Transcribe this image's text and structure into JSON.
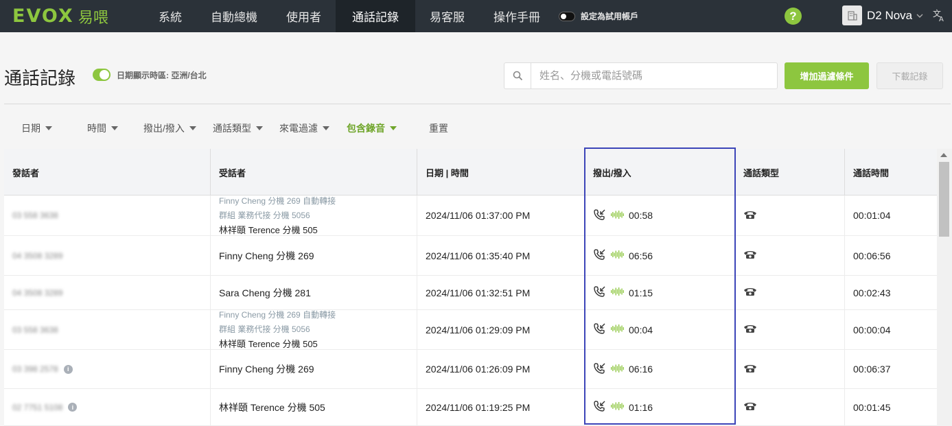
{
  "nav": {
    "logo_text": "EVOX",
    "logo_cn": "易喂",
    "items": [
      "系統",
      "自動總機",
      "使用者",
      "通話記錄",
      "易客服",
      "操作手冊"
    ],
    "active_index": 3,
    "trial_label": "設定為試用帳戶",
    "help": "?",
    "account_name": "D2 Nova",
    "lang_icon": "translate-icon"
  },
  "header": {
    "title": "通話記錄",
    "timezone_label": "日期顯示時區: 亞洲/台北",
    "search_placeholder": "姓名、分機或電話號碼",
    "add_filter": "增加過濾條件",
    "download": "下載記錄"
  },
  "filters": [
    "日期",
    "時間",
    "撥出/撥入",
    "通話類型",
    "來電過濾",
    "包含錄音"
  ],
  "filter_reset": "重置",
  "active_filter": "包含錄音",
  "table": {
    "columns": [
      "發話者",
      "受話者",
      "日期 | 時間",
      "撥出/撥入",
      "通話類型",
      "通話時間"
    ],
    "rows": [
      {
        "caller": "03 558 3638",
        "info": false,
        "callee_sub1": "Finny Cheng  分機 269  自動轉接",
        "callee_sub2": "群組  業務代接  分機 5056",
        "callee": "林祥頤 Terence  分機 505",
        "datetime": "2024/11/06 01:37:00 PM",
        "ring": "00:58",
        "duration": "00:01:04"
      },
      {
        "caller": "04 3508 3289",
        "info": false,
        "callee_sub1": "",
        "callee_sub2": "",
        "callee": "Finny Cheng  分機 269",
        "datetime": "2024/11/06 01:35:40 PM",
        "ring": "06:56",
        "duration": "00:06:56"
      },
      {
        "caller": "04 3508 3289",
        "info": false,
        "callee_sub1": "",
        "callee_sub2": "",
        "callee": "Sara Cheng  分機 281",
        "datetime": "2024/11/06 01:32:51 PM",
        "ring": "01:15",
        "duration": "00:02:43"
      },
      {
        "caller": "03 558 3638",
        "info": false,
        "callee_sub1": "Finny Cheng  分機 269  自動轉接",
        "callee_sub2": "群組  業務代接  分機 5056",
        "callee": "林祥頤 Terence  分機 505",
        "datetime": "2024/11/06 01:29:09 PM",
        "ring": "00:04",
        "duration": "00:00:04"
      },
      {
        "caller": "03 398 2578",
        "info": true,
        "callee_sub1": "",
        "callee_sub2": "",
        "callee": "Finny Cheng  分機 269",
        "datetime": "2024/11/06 01:26:09 PM",
        "ring": "06:16",
        "duration": "00:06:37"
      },
      {
        "caller": "02 7751 5108",
        "info": true,
        "callee_sub1": "",
        "callee_sub2": "",
        "callee": "林祥頤 Terence  分機 505",
        "datetime": "2024/11/06 01:19:25 PM",
        "ring": "01:16",
        "duration": "00:01:45"
      }
    ]
  },
  "colors": {
    "accent": "#8dc63f",
    "nav_bg": "#2b3239",
    "highlight": "#3b44b8"
  }
}
